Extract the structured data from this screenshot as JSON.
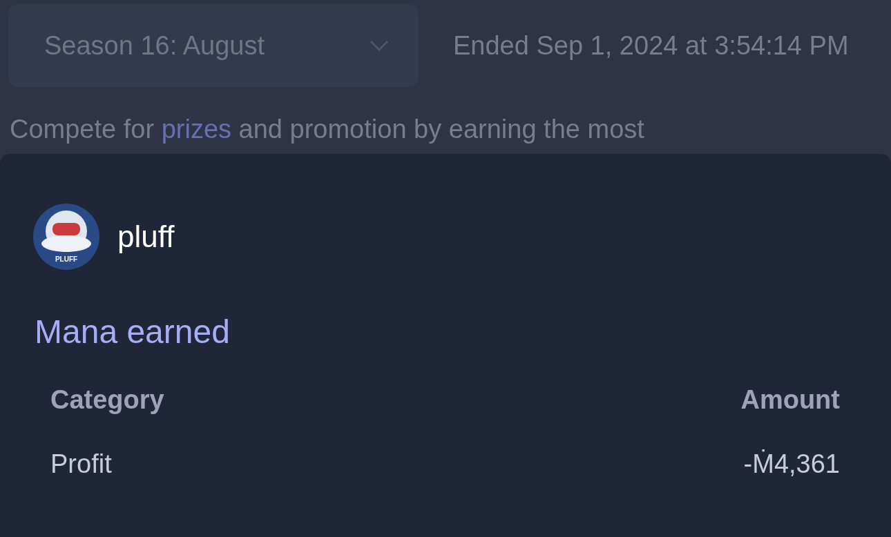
{
  "season_select": {
    "value": "Season 16: August"
  },
  "ended": "Ended Sep 1, 2024 at 3:54:14 PM",
  "intro": {
    "before": "Compete for ",
    "link": "prizes",
    "after": " and promotion by earning the most"
  },
  "sheet": {
    "user": {
      "name": "pluff",
      "avatar_label": "PLUFF"
    },
    "title": "Mana earned",
    "table": {
      "columns": [
        "Category",
        "Amount"
      ],
      "rows": [
        {
          "category": "Profit",
          "amount": "-Ṁ4,361"
        }
      ]
    }
  }
}
